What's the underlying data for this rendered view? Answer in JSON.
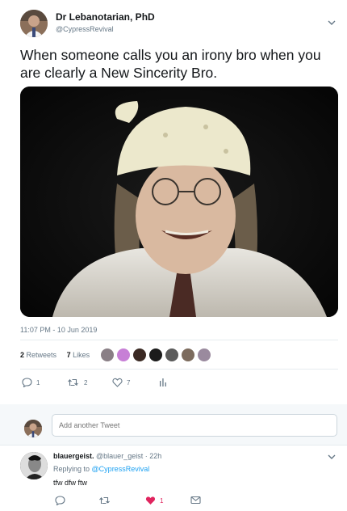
{
  "tweet": {
    "author_name": "Dr Lebanotarian, PhD",
    "author_handle": "@CypressRevival",
    "text": "When someone calls you an irony bro when you are clearly a New Sincerity Bro.",
    "timestamp": "11:07 PM - 10 Jun 2019",
    "retweets_count": "2",
    "retweets_label": "Retweets",
    "likes_count": "7",
    "likes_label": "Likes",
    "actions": {
      "reply_count": "1",
      "retweet_count": "2",
      "like_count": "7"
    },
    "liker_colors": [
      "#8a7f86",
      "#c77fd6",
      "#3b2a24",
      "#1b1b1b",
      "#5b5b5b",
      "#7c6b5d",
      "#9a8a9e"
    ]
  },
  "compose": {
    "placeholder": "Add another Tweet"
  },
  "reply": {
    "author_name": "blauergeist.",
    "author_handle": "@blauer_geist",
    "separator": "·",
    "time": "22h",
    "replying_prefix": "Replying to",
    "replying_to": "@CypressRevival",
    "text": "tfw dfw ftw",
    "actions": {
      "like_count": "1"
    }
  },
  "colors": {
    "accent": "#1da1f2",
    "like_active": "#e0245e",
    "secondary_text": "#657786",
    "border": "#e6ecf0"
  },
  "icons": {
    "reply": "reply-bubble-icon",
    "retweet": "retweet-icon",
    "like": "heart-icon",
    "analytics": "analytics-bars-icon",
    "message": "envelope-icon",
    "menu": "chevron-down-icon"
  }
}
